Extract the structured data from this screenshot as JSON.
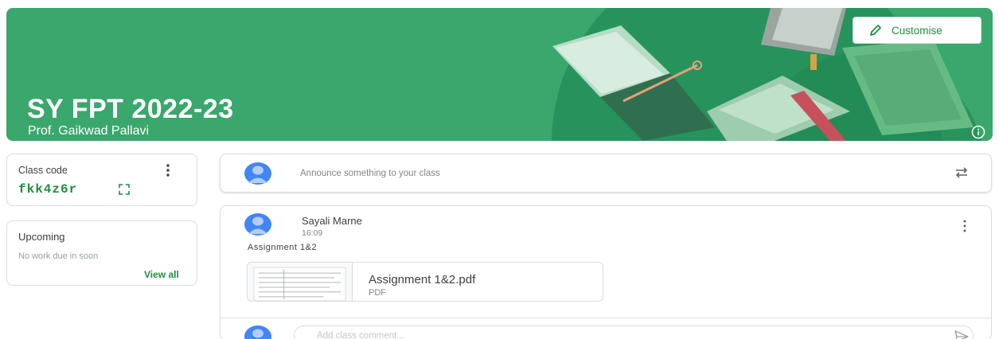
{
  "banner": {
    "title": "SY FPT 2022-23",
    "subtitle": "Prof. Gaikwad Pallavi",
    "customise_label": "Customise",
    "bg_color": "#3aa76d"
  },
  "class_code": {
    "label": "Class code",
    "value": "fkk4z6r"
  },
  "upcoming": {
    "title": "Upcoming",
    "text": "No work due in soon",
    "view_all": "View all"
  },
  "announce": {
    "placeholder": "Announce something to your class"
  },
  "post": {
    "author": "Sayali Marne",
    "time": "16:09",
    "body": "Assignment 1&2",
    "attachment": {
      "name": "Assignment 1&2.pdf",
      "type": "PDF"
    }
  },
  "comment": {
    "placeholder": "Add class comment..."
  },
  "colors": {
    "accent": "#1e8e3e",
    "avatar": "#4285f4"
  },
  "icons": [
    "pencil-icon",
    "info-icon",
    "kebab-menu-icon",
    "expand-icon",
    "repost-icon",
    "send-icon",
    "avatar-icon"
  ]
}
